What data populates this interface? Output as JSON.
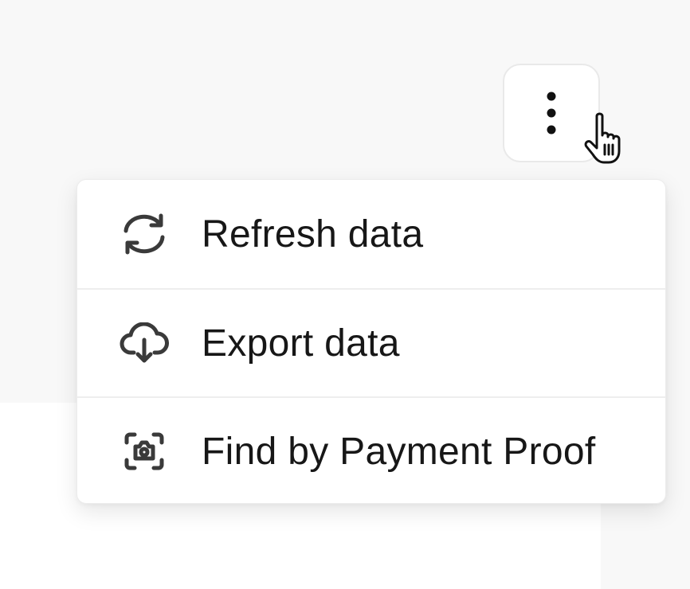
{
  "toolbar": {
    "more_button_icon": "more-vertical-icon"
  },
  "menu": {
    "items": [
      {
        "label": "Refresh data",
        "icon": "refresh-icon"
      },
      {
        "label": "Export data",
        "icon": "cloud-download-icon"
      },
      {
        "label": "Find by Payment Proof",
        "icon": "scan-camera-icon"
      }
    ]
  },
  "colors": {
    "background": "#f8f8f8",
    "surface": "#ffffff",
    "text": "#171717",
    "icon": "#3a3a3a",
    "border": "#e9e9e9"
  },
  "cursor": {
    "icon": "hand-pointer-icon"
  }
}
